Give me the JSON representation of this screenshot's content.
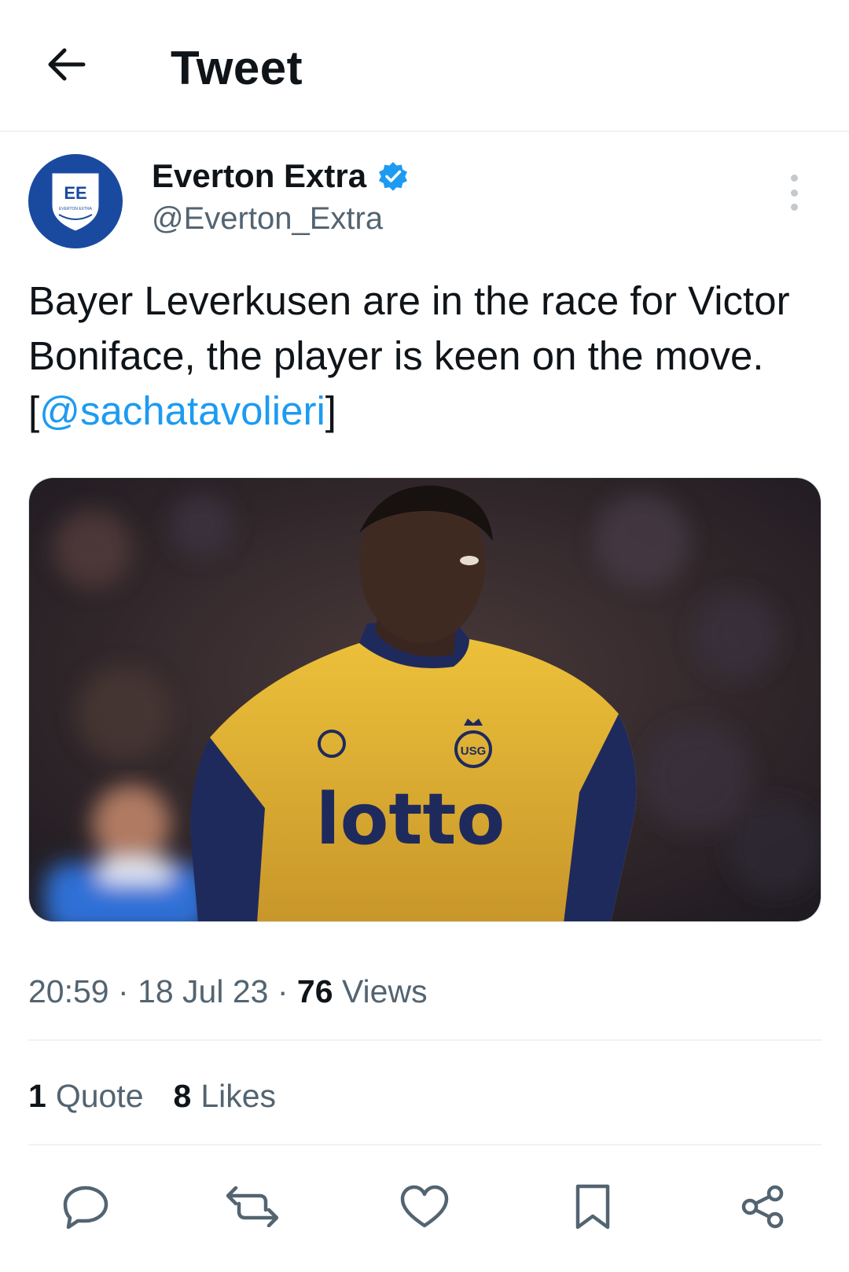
{
  "header": {
    "title": "Tweet"
  },
  "author": {
    "name": "Everton Extra",
    "handle": "@Everton_Extra",
    "avatar_initials": "EE",
    "avatar_subtext": "EVERTON EXTRA"
  },
  "tweet": {
    "text": "Bayer Leverkusen are in the race for Victor Boniface, the player is keen on the move. [",
    "mention": "@sachatavolieri",
    "text_end": "]"
  },
  "media": {
    "jersey_sponsor": "lotto",
    "crest_text": "USG"
  },
  "meta": {
    "time": "20:59",
    "date": "18 Jul 23",
    "views_count": "76",
    "views_label": "Views"
  },
  "stats": {
    "quotes_count": "1",
    "quotes_label": "Quote",
    "likes_count": "8",
    "likes_label": "Likes"
  },
  "colors": {
    "accent": "#1d9bf0",
    "avatar": "#1a4aa0",
    "jersey": "#e3b52c",
    "jersey_trim": "#1f2a5c"
  }
}
